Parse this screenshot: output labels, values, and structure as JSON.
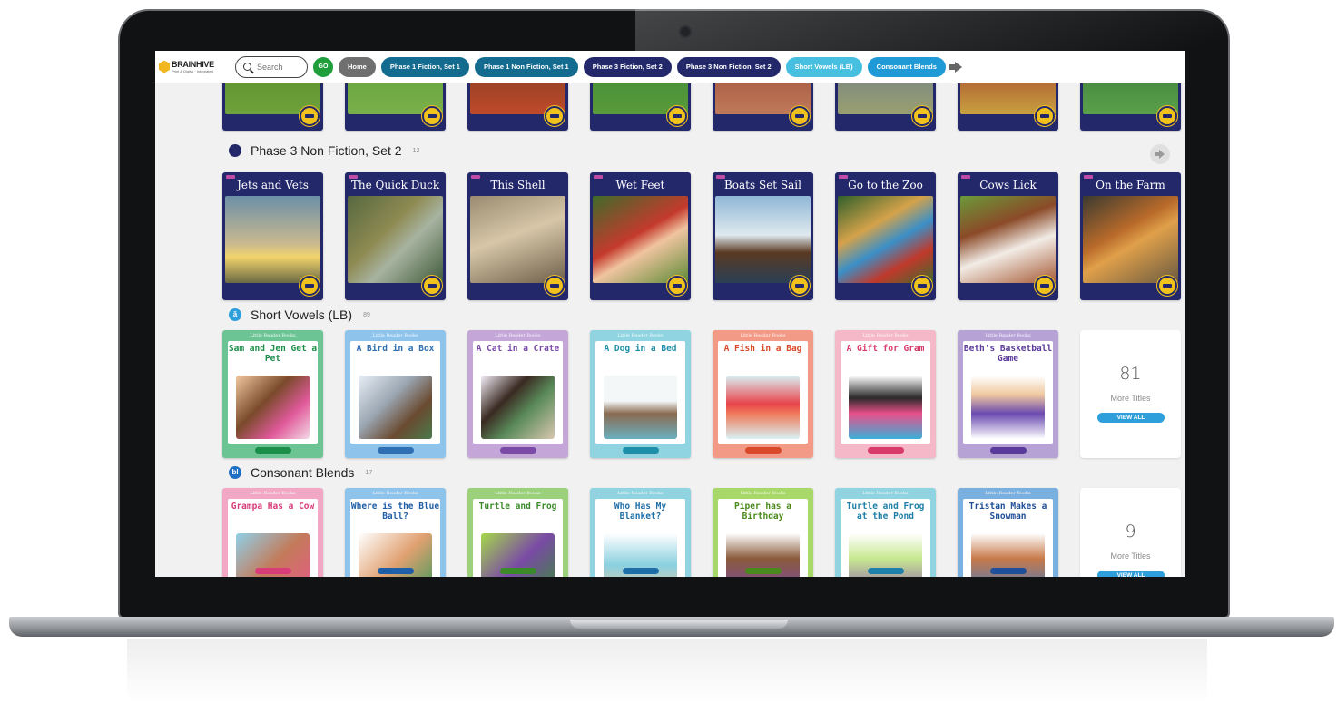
{
  "app": {
    "logo": "BRAINHIVE",
    "logo_tagline": "Print & Digital · Integrated"
  },
  "search": {
    "placeholder": "Search",
    "go_label": "GO"
  },
  "nav": {
    "pills": [
      {
        "label": "Home",
        "color": "#6f6f6f"
      },
      {
        "label": "Phase 1 Fiction, Set 1",
        "color": "#136b8f"
      },
      {
        "label": "Phase 1 Non Fiction, Set 1",
        "color": "#136b8f"
      },
      {
        "label": "Phase 3 Fiction, Set 2",
        "color": "#23286b"
      },
      {
        "label": "Phase 3 Non Fiction, Set 2",
        "color": "#23286b"
      },
      {
        "label": "Short Vowels (LB)",
        "color": "#47bfe0"
      },
      {
        "label": "Consonant Blends",
        "color": "#1f9ad6"
      }
    ]
  },
  "sections": {
    "phase3nf": {
      "title": "Phase 3 Non Fiction, Set 2",
      "count": "12",
      "color": "#23286b",
      "books": [
        {
          "title": "Jets and Vets",
          "art": "linear-gradient(#6c8fa8 0%, #c9b98f 55%, #f2d36b 70%, #6b6a45 100%)"
        },
        {
          "title": "The Quick Duck",
          "art": "linear-gradient(135deg, #56683f 0%, #8e8a52 40%, #a7b3a0 60%, #3f5a3a 100%)"
        },
        {
          "title": "This Shell",
          "art": "linear-gradient(160deg, #9a8a70 0%, #d7c7a8 45%, #6e5f4a 100%)"
        },
        {
          "title": "Wet Feet",
          "art": "linear-gradient(150deg, #3f6b2a 0%, #c43a2d 45%, #f0c4a0 60%, #5c8a34 100%)"
        },
        {
          "title": "Boats Set Sail",
          "art": "linear-gradient(#8fb7d6 0%, #dfe9ee 45%, #5a3a22 65%, #2a3f55 100%)"
        },
        {
          "title": "Go to the Zoo",
          "art": "linear-gradient(150deg, #2e5f2a 0%, #d4a24a 35%, #3b8fc7 55%, #c0392b 75%, #3d6b2d 100%)"
        },
        {
          "title": "Cows Lick",
          "art": "linear-gradient(160deg, #6a9a3a 0%, #8b4a28 35%, #f2ece6 60%, #a65a35 100%)"
        },
        {
          "title": "On the Farm",
          "art": "linear-gradient(150deg, #3a3a30 0%, #b86a2a 40%, #e0a04a 55%, #6a5a40 100%)"
        }
      ]
    },
    "short_vowels": {
      "title": "Short Vowels (LB)",
      "icon": "ă",
      "count": "89",
      "color": "#2f9fdc",
      "series_label": "Little Reader Books",
      "books": [
        {
          "title": "Sam and Jen Get a Pet",
          "bg": "#6cc494",
          "text_color": "#1b8f4a",
          "art": "linear-gradient(135deg, #f2c7a0 0%, #7a4a2a 40%, #e05a9a 70%, #f4d9e6 100%)"
        },
        {
          "title": "A Bird in a Box",
          "bg": "#8ec4ec",
          "text_color": "#2f6fb3",
          "art": "linear-gradient(135deg, #e8eef6 0%, #9aa6b2 40%, #6a4a30 70%, #4a7a4a 100%)"
        },
        {
          "title": "A Cat in a Crate",
          "bg": "#c4a6d8",
          "text_color": "#7a4aa6",
          "art": "linear-gradient(135deg, #f4eef8 0%, #3a2a22 35%, #5a8a5a 60%, #d8c7b0 100%)"
        },
        {
          "title": "A Dog in a Bed",
          "bg": "#8fd4e0",
          "text_color": "#1e8fa8",
          "art": "linear-gradient(#f3f7f8 0%, #f3f7f8 40%, #8a6a50 60%, #6ab0bf 100%)"
        },
        {
          "title": "A Fish in a Bag",
          "bg": "#f29a86",
          "text_color": "#d84a2a",
          "art": "linear-gradient(#d9f0f4 0%, #e8434a 45%, #f07a5a 60%, #d9f0f4 100%)"
        },
        {
          "title": "A Gift for Gram",
          "bg": "#f5b8c8",
          "text_color": "#d83a6a",
          "art": "linear-gradient(#fff 0%, #2a2a2a 35%, #e8508a 60%, #3ab0d8 100%)"
        },
        {
          "title": "Beth's Basketball Game",
          "bg": "#b7a2d6",
          "text_color": "#5a3a9a",
          "art": "linear-gradient(#fff 0%, #f0c8a0 30%, #6a4ab0 60%, #fff 100%)"
        }
      ],
      "more_count": "81",
      "more_label": "More Titles",
      "view_all": "VIEW ALL"
    },
    "consonant_blends": {
      "title": "Consonant Blends",
      "icon": "bl",
      "count": "17",
      "color": "#1f6fc4",
      "series_label": "Little Reader Books",
      "books": [
        {
          "title": "Grampa Has a Cow",
          "bg": "#f2a8c4",
          "text_color": "#d83a7a",
          "art": "linear-gradient(135deg, #8fd0e8 0%, #c47a5a 50%, #e85a8a 100%)"
        },
        {
          "title": "Where is the Blue Ball?",
          "bg": "#8ec4ec",
          "text_color": "#1f5fa8",
          "art": "linear-gradient(135deg, #fff 0%, #e0a070 50%, #3a9a5a 100%)"
        },
        {
          "title": "Turtle and Frog",
          "bg": "#9ad17a",
          "text_color": "#3a8a2a",
          "art": "linear-gradient(135deg, #a6d84a 0%, #7a4aa6 50%, #3a8a3a 100%)"
        },
        {
          "title": "Who Has My Blanket?",
          "bg": "#8fd4e0",
          "text_color": "#1e6fa8",
          "art": "linear-gradient(#fff 0%, #8ad0e0 50%, #f0c8a0 100%)"
        },
        {
          "title": "Piper has a Birthday",
          "bg": "#a8d86a",
          "text_color": "#4a8a1a",
          "art": "linear-gradient(#fff 0%, #8a5a3a 40%, #7a4ab0 100%)"
        },
        {
          "title": "Turtle and Frog at the Pond",
          "bg": "#8fd4e0",
          "text_color": "#1e7fa8",
          "art": "linear-gradient(#fff 0%, #c8e890 40%, #8a5ab0 100%)"
        },
        {
          "title": "Tristan Makes a Snowman",
          "bg": "#7ab0e0",
          "text_color": "#1f4f98",
          "art": "linear-gradient(#fff 0%, #c87a4a 40%, #3a7ac8 100%)"
        }
      ],
      "more_count": "9",
      "more_label": "More Titles",
      "view_all": "VIEW ALL"
    }
  },
  "prev_row": {
    "books": [
      {
        "art": "linear-gradient(#5a8a2a, #6ea23a)"
      },
      {
        "art": "linear-gradient(#5fa03a, #7ab04a)"
      },
      {
        "art": "linear-gradient(#7a3a22, #c04a2a)"
      },
      {
        "art": "linear-gradient(#3a8a3a, #5a9a3a)"
      },
      {
        "art": "linear-gradient(#9a4a35, #c07a5a)"
      },
      {
        "art": "linear-gradient(#6a7a8a, #9aa070)"
      },
      {
        "art": "linear-gradient(#a03a2a, #c8a040)"
      },
      {
        "art": "linear-gradient(#3a7a3a, #5aa04a)"
      }
    ]
  }
}
